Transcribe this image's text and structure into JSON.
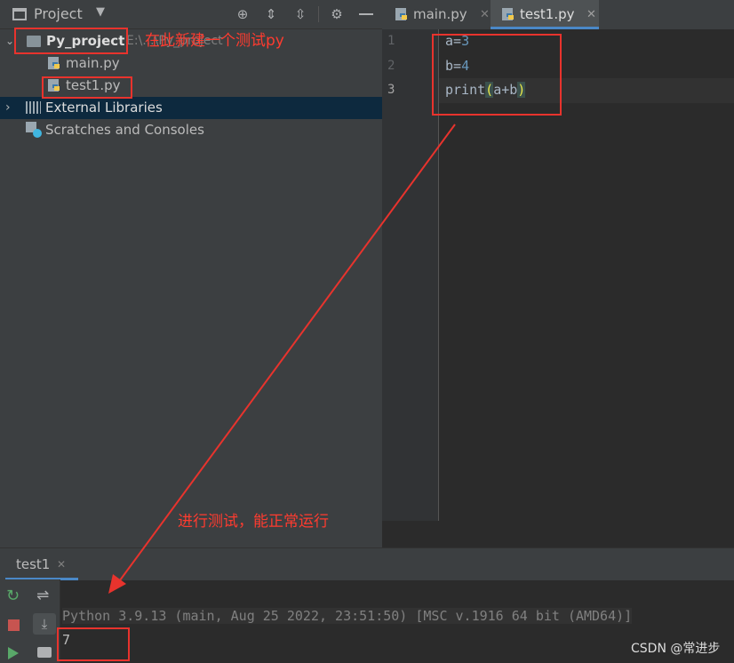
{
  "project_panel": {
    "title": "Project",
    "tree": {
      "root_label": "Py_project",
      "root_path_hint": "E:\\...\\Py_project",
      "files": [
        "main.py",
        "test1.py"
      ],
      "external_libraries": "External Libraries",
      "scratches": "Scratches and Consoles"
    }
  },
  "editor": {
    "tabs": [
      {
        "label": "main.py",
        "active": false
      },
      {
        "label": "test1.py",
        "active": true
      }
    ],
    "line_numbers": [
      "1",
      "2",
      "3"
    ],
    "code": {
      "line1_var": "a",
      "line1_op": "=",
      "line1_val": "3",
      "line2_var": "b",
      "line2_op": "=",
      "line2_val": "4",
      "line3_func": "print",
      "line3_open": "(",
      "line3_args": "a+b",
      "line3_close": ")"
    }
  },
  "run": {
    "tab_label": "test1",
    "console_header": "Python 3.9.13 (main, Aug 25 2022, 23:51:50) [MSC v.1916 64 bit (AMD64)]",
    "output": "7"
  },
  "annotations": {
    "new_file_note": "在此新建一个测试py",
    "run_note": "进行测试，能正常运行"
  },
  "watermark": "CSDN @常进步",
  "colors": {
    "annotation": "#e8332d",
    "number": "#6897bb",
    "paren": "#e8e84a",
    "selection": "#0d293e"
  }
}
